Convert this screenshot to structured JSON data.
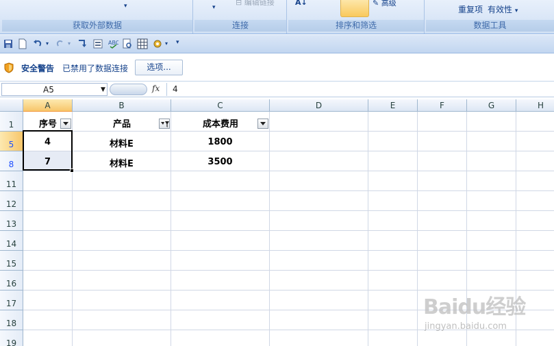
{
  "ribbon": {
    "groups": [
      {
        "label": "获取外部数据"
      },
      {
        "label": "连接"
      },
      {
        "label": "排序和筛选"
      },
      {
        "label": "数据工具"
      }
    ],
    "edit_links_label": "编辑链接",
    "advanced_label": "高级",
    "remove_duplicates_label": "重复项",
    "validation_label": "有效性",
    "validation_arrow": "▾"
  },
  "security_bar": {
    "title": "安全警告",
    "message": "已禁用了数据连接",
    "options_button": "选项..."
  },
  "formula_bar": {
    "name_box": "A5",
    "fx_label": "fx",
    "formula": "4"
  },
  "grid": {
    "columns": [
      "A",
      "B",
      "C",
      "D",
      "E",
      "F",
      "G",
      "H"
    ],
    "rows": [
      {
        "num": "1"
      },
      {
        "num": "5"
      },
      {
        "num": "8"
      },
      {
        "num": "11"
      },
      {
        "num": "12"
      },
      {
        "num": "13"
      },
      {
        "num": "14"
      },
      {
        "num": "15"
      },
      {
        "num": "16"
      },
      {
        "num": "17"
      },
      {
        "num": "18"
      },
      {
        "num": "19"
      }
    ],
    "headers": {
      "a": "序号",
      "b": "产品",
      "c": "成本费用"
    },
    "data_rows": [
      {
        "a": "4",
        "b": "材料E",
        "c": "1800"
      },
      {
        "a": "7",
        "b": "材料E",
        "c": "3500"
      }
    ]
  },
  "watermark": {
    "text": "Baidu经验",
    "url": "jingyan.baidu.com"
  },
  "colors": {
    "accent": "#15428b",
    "selected_header": "#f7c66b",
    "filtered_row_num": "#1f4fff"
  }
}
